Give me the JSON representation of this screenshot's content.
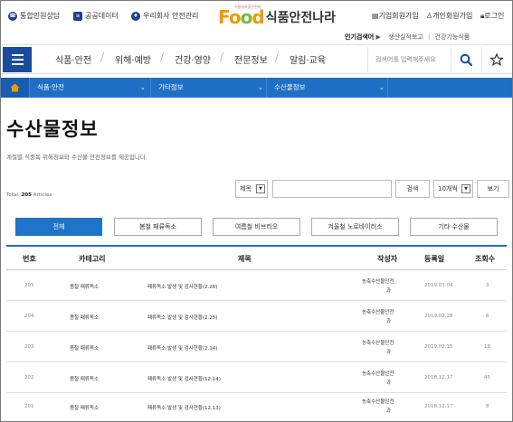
{
  "util": {
    "links": [
      {
        "label": "통합민원상담",
        "icon": "headset-icon"
      },
      {
        "label": "공공데이터",
        "icon": "database-icon"
      },
      {
        "label": "우리회사 안전관리",
        "icon": "shield-icon"
      }
    ],
    "member": [
      {
        "label": "기업회원가입",
        "icon": "building-icon"
      },
      {
        "label": "개인회원가입",
        "icon": "person-icon"
      },
      {
        "label": "로그인",
        "icon": "lock-icon"
      }
    ]
  },
  "logo": {
    "food": "Food",
    "name": "식품안전나라",
    "tagline": "식품의약품안전처"
  },
  "popular": {
    "label": "인기검색어",
    "items": [
      "생산실적보고",
      "건강기능식품"
    ]
  },
  "gnb": {
    "items": [
      "식품·안전",
      "위해·예방",
      "건강·영양",
      "전문정보",
      "알림·교육"
    ],
    "search_placeholder": "검색어를 입력해주세요"
  },
  "location": {
    "items": [
      "식품·안전",
      "기타정보",
      "수산물정보"
    ]
  },
  "page": {
    "title": "수산물정보",
    "description": "계절별 식중독 위해정보와 수산물 안전정보를 제공합니다."
  },
  "list": {
    "total_prefix": "Total: ",
    "total_count": "205",
    "total_suffix": " Articles",
    "search_field": "제목",
    "search_value": "",
    "search_button": "검색",
    "page_size": "10개씩",
    "view_button": "보기"
  },
  "categories": [
    "전체",
    "봄철 패류독소",
    "여름철 비브리오",
    "겨울철 노로바이러스",
    "기타 수산물"
  ],
  "table": {
    "headers": [
      "번호",
      "카테고리",
      "제목",
      "작성자",
      "등록일",
      "조회수"
    ],
    "rows": [
      {
        "num": "205",
        "category": "봄철 패류독소",
        "title": "패류독소 발생 및 검사현황(2.28)",
        "author1": "농축수산물안전",
        "author2": "과",
        "date": "2019.03.04",
        "views": "3"
      },
      {
        "num": "204",
        "category": "봄철 패류독소",
        "title": "패류독소 발생 및 검사현황(2.25)",
        "author1": "농축수산물안전",
        "author2": "과",
        "date": "2019.02.28",
        "views": "6"
      },
      {
        "num": "203",
        "category": "봄철 패류독소",
        "title": "패류독소 발생 및 검사현황(2.14)",
        "author1": "농축수산물안전",
        "author2": "과",
        "date": "2019.02.15",
        "views": "18"
      },
      {
        "num": "202",
        "category": "봄철 패류독소",
        "title": "패류독소 발생 및 검사현황(12.14)",
        "author1": "농축수산물안전",
        "author2": "과",
        "date": "2018.12.17",
        "views": "45"
      },
      {
        "num": "201",
        "category": "봄철 패류독소",
        "title": "패류독소 발생 및 검사현황(12.13)",
        "author1": "농축수산물안전",
        "author2": "과",
        "date": "2018.12.17",
        "views": "8"
      }
    ]
  },
  "colors": {
    "primary": "#1f6fc5",
    "logo_orange": "#f39800",
    "logo_green": "#7cb83a"
  }
}
